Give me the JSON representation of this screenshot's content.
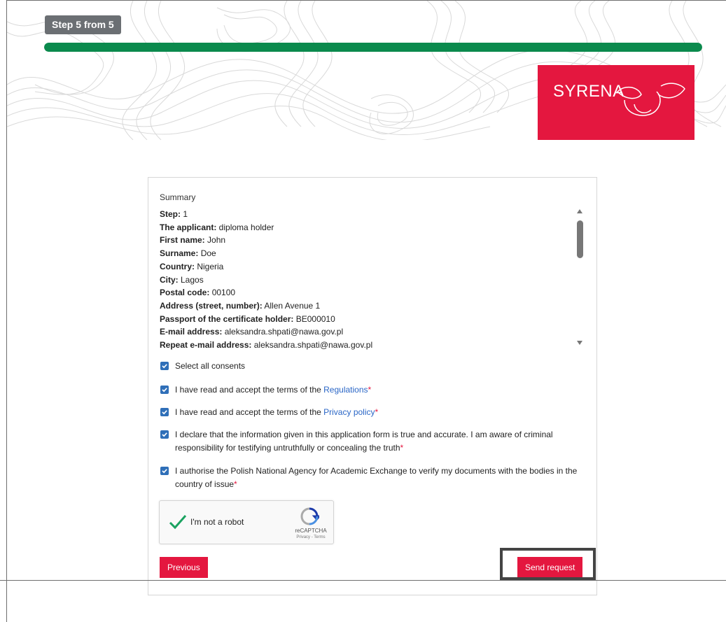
{
  "progress": {
    "step_label": "Step 5 from 5",
    "fraction": 1.0,
    "color": "#0b8a4d"
  },
  "logo": {
    "text": "SYRENA",
    "background": "#e4173f"
  },
  "summary": {
    "title": "Summary",
    "lines": [
      {
        "key": "Step:",
        "value": " 1"
      },
      {
        "key": "The applicant:",
        "value": " diploma holder"
      },
      {
        "key": "First name:",
        "value": " John"
      },
      {
        "key": "Surname:",
        "value": " Doe"
      },
      {
        "key": "Country:",
        "value": " Nigeria"
      },
      {
        "key": "City:",
        "value": " Lagos"
      },
      {
        "key": "Postal code:",
        "value": " 00100"
      },
      {
        "key": "Address (street, number):",
        "value": " Allen Avenue 1"
      },
      {
        "key": "Passport of the certificate holder:",
        "value": " BE000010"
      },
      {
        "key": "E-mail address:",
        "value": " aleksandra.shpati@nawa.gov.pl"
      },
      {
        "key": "Repeat e-mail address:",
        "value": " aleksandra.shpati@nawa.gov.pl"
      }
    ]
  },
  "consents": {
    "select_all": "Select all consents",
    "regulations_prefix": "I have read and accept the terms of the ",
    "regulations_link": "Regulations",
    "privacy_prefix": "I have read and accept the terms of the ",
    "privacy_link": "Privacy policy",
    "declare": "I declare that the information given in this application form is true and accurate. I am aware of criminal responsibility for testifying untruthfully or concealing the truth",
    "authorise": "I authorise the Polish National Agency for Academic Exchange to verify my documents with the bodies in the country of issue",
    "required_mark": "*"
  },
  "captcha": {
    "label": "I'm not a robot",
    "brand": "reCAPTCHA",
    "terms": "Privacy - Terms"
  },
  "buttons": {
    "previous": "Previous",
    "send": "Send request"
  },
  "colors": {
    "accent": "#e4173f",
    "checkbox": "#2f6fb8",
    "link": "#2a66c6",
    "badge": "#6b6f73"
  }
}
